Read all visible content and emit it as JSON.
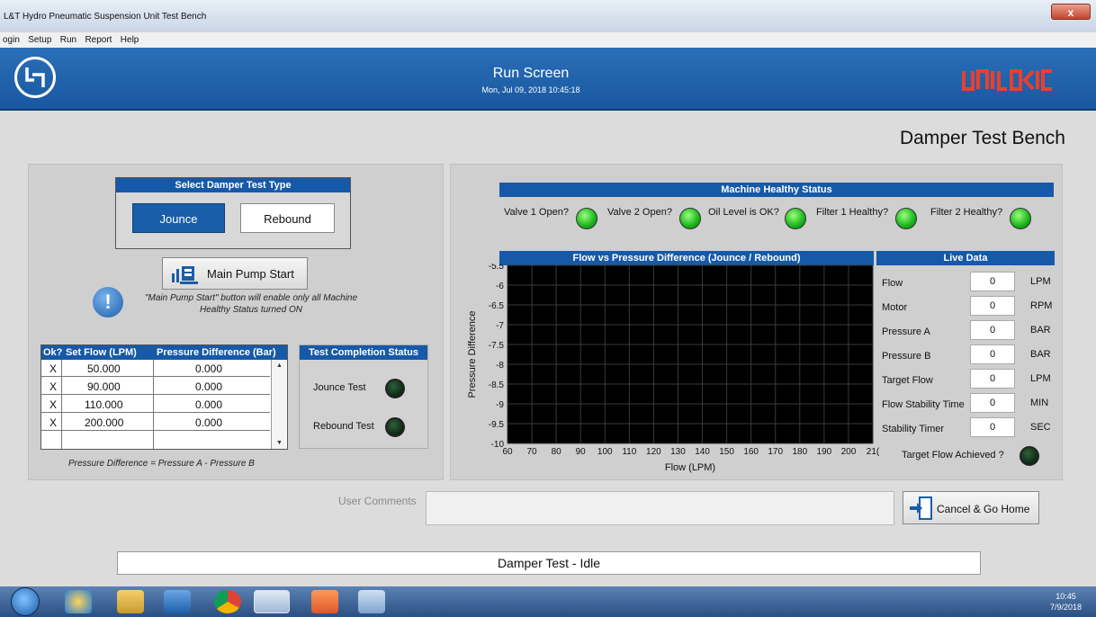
{
  "window": {
    "title": "L&T Hydro Pneumatic Suspension Unit Test Bench",
    "close_label": "x"
  },
  "menu": [
    "ogin",
    "Setup",
    "Run",
    "Report",
    "Help"
  ],
  "header": {
    "screen_title": "Run Screen",
    "datetime": "Mon, Jul 09, 2018 10:45:18",
    "brand_right": "UNILOGIC"
  },
  "bench_title": "Damper Test Bench",
  "test_type": {
    "heading": "Select Damper Test Type",
    "jounce_label": "Jounce",
    "rebound_label": "Rebound",
    "selected": "Jounce"
  },
  "pump": {
    "button_label": "Main Pump Start",
    "info_line1": "\"Main Pump Start\" button will enable only all Machine",
    "info_line2": "Healthy Status turned ON"
  },
  "flow_table": {
    "headers": [
      "Ok?",
      "Set Flow (LPM)",
      "Pressure Difference (Bar)"
    ],
    "rows": [
      {
        "ok": "X",
        "flow": "50.000",
        "pd": "0.000"
      },
      {
        "ok": "X",
        "flow": "90.000",
        "pd": "0.000"
      },
      {
        "ok": "X",
        "flow": "110.000",
        "pd": "0.000"
      },
      {
        "ok": "X",
        "flow": "200.000",
        "pd": "0.000"
      },
      {
        "ok": "",
        "flow": "",
        "pd": ""
      }
    ]
  },
  "formula": "Pressure Difference = Pressure A - Pressure B",
  "completion": {
    "heading": "Test Completion Status",
    "jounce_label": "Jounce Test",
    "rebound_label": "Rebound Test"
  },
  "machine_status": {
    "heading": "Machine Healthy Status",
    "items": [
      {
        "label": "Valve 1 Open?",
        "state": "on"
      },
      {
        "label": "Valve 2 Open?",
        "state": "on"
      },
      {
        "label": "Oil Level is OK?",
        "state": "on"
      },
      {
        "label": "Filter 1 Healthy?",
        "state": "on"
      },
      {
        "label": "Filter 2 Healthy?",
        "state": "on"
      }
    ],
    "on_color": "#22c21f"
  },
  "chart_data": {
    "type": "line",
    "title": "Flow vs Pressure Difference (Jounce / Rebound)",
    "xlabel": "Flow (LPM)",
    "ylabel": "Pressure Difference",
    "xlim": [
      60,
      210
    ],
    "ylim": [
      -10,
      -5.5
    ],
    "x_ticks": [
      "60",
      "70",
      "80",
      "90",
      "100",
      "110",
      "120",
      "130",
      "140",
      "150",
      "160",
      "170",
      "180",
      "190",
      "200",
      "21("
    ],
    "y_ticks": [
      "-5.5",
      "-6",
      "-6.5",
      "-7",
      "-7.5",
      "-8",
      "-8.5",
      "-9",
      "-9.5",
      "-10"
    ],
    "grid": true,
    "background": "#000000",
    "series": []
  },
  "live_data": {
    "heading": "Live Data",
    "rows": [
      {
        "label": "Flow",
        "value": "0",
        "unit": "LPM"
      },
      {
        "label": "Motor",
        "value": "0",
        "unit": "RPM"
      },
      {
        "label": "Pressure A",
        "value": "0",
        "unit": "BAR"
      },
      {
        "label": "Pressure B",
        "value": "0",
        "unit": "BAR"
      },
      {
        "label": "Target Flow",
        "value": "0",
        "unit": "LPM"
      },
      {
        "label": "Flow Stability Time",
        "value": "0",
        "unit": "MIN"
      },
      {
        "label": "Stability Timer",
        "value": "0",
        "unit": "SEC"
      }
    ],
    "target_achieved_label": "Target Flow Achieved ?"
  },
  "comments": {
    "label": "User Comments",
    "value": ""
  },
  "cancel_label": "Cancel & Go Home",
  "status_text": "Damper Test - Idle",
  "taskbar": {
    "time": "10:45",
    "date": "7/9/2018"
  }
}
